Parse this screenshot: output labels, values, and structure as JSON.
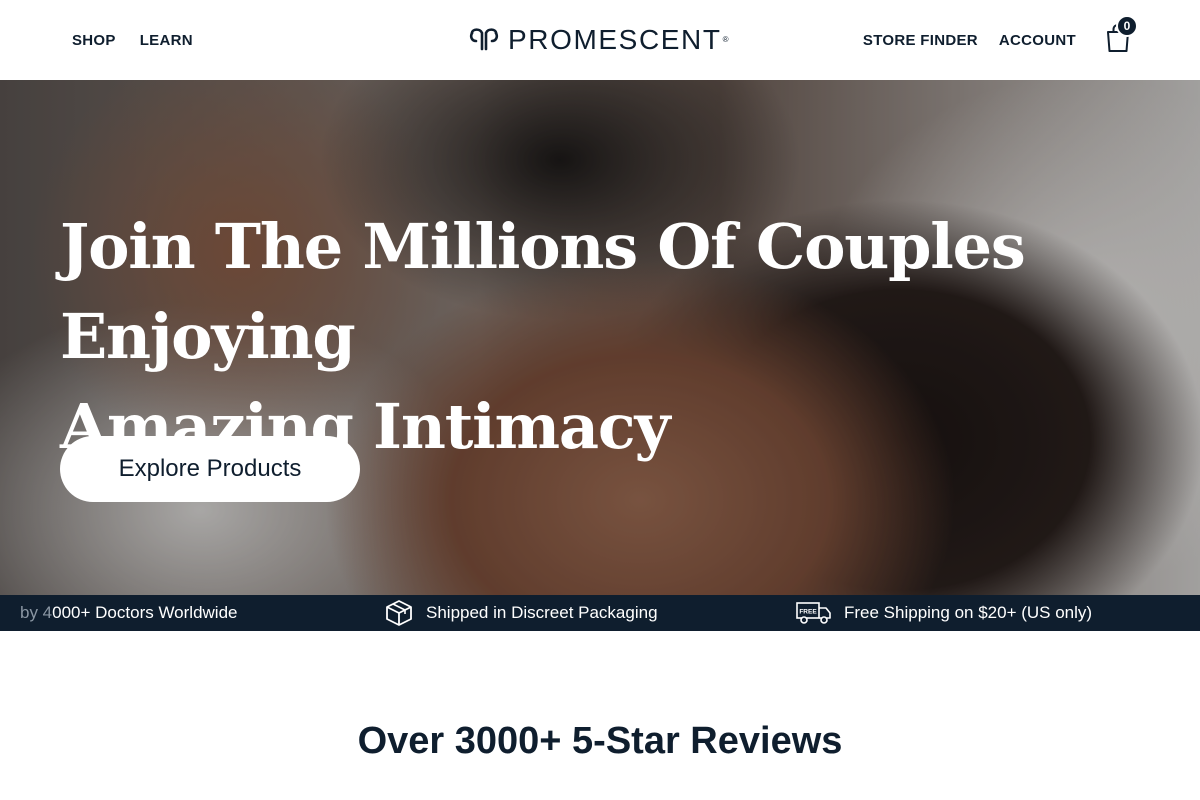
{
  "header": {
    "nav_left": [
      {
        "label": "SHOP"
      },
      {
        "label": "LEARN"
      }
    ],
    "logo_text": "PROMESCENT",
    "logo_tm": "®",
    "nav_right": [
      {
        "label": "STORE FINDER"
      },
      {
        "label": "ACCOUNT"
      }
    ],
    "cart_count": "0"
  },
  "hero": {
    "title_line1": "Join The Millions Of Couples Enjoying",
    "title_line2": "Amazing Intimacy",
    "cta_label": "Explore Products"
  },
  "trust_bar": {
    "item1_fade": "by 4",
    "item1_rest": "000+ Doctors Worldwide",
    "item2": "Shipped in Discreet Packaging",
    "item3": "Free Shipping on $20+ (US only)",
    "item3_icon_text": "FREE"
  },
  "reviews": {
    "title": "Over 3000+ 5-Star Reviews"
  },
  "colors": {
    "navy": "#0f1e2e",
    "white": "#ffffff"
  },
  "icons": [
    "logo-mark-icon",
    "cart-icon",
    "package-box-icon",
    "free-shipping-truck-icon"
  ]
}
